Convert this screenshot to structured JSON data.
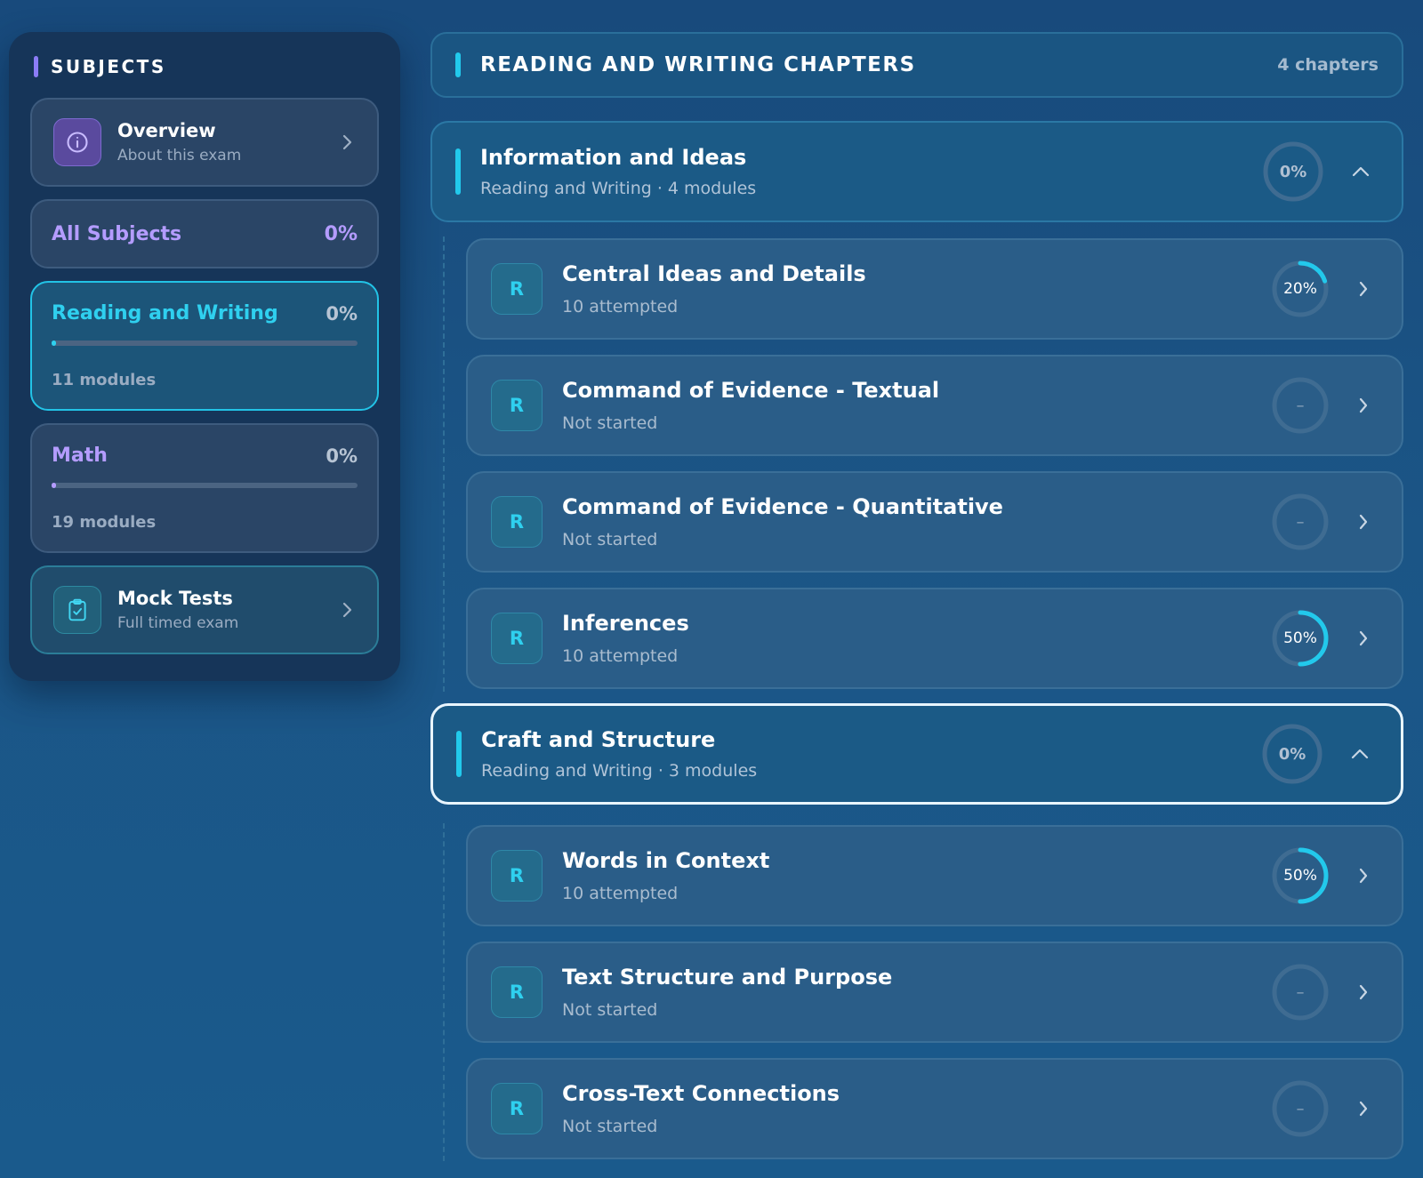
{
  "colors": {
    "accent_cyan": "#22c9ec",
    "accent_purple": "#8b7cf6",
    "reading_color": "#2fd0ef",
    "math_color": "#b49cff",
    "ring_track": "#3f6c92"
  },
  "sidebar": {
    "heading": "SUBJECTS",
    "overview": {
      "icon": "info-icon",
      "title": "Overview",
      "subtitle": "About this exam"
    },
    "all_subjects": {
      "label": "All Subjects",
      "percent": "0%"
    },
    "subjects": [
      {
        "name": "Reading and Writing",
        "percent": "0%",
        "progress": 0.01,
        "modules": "11 modules",
        "active": true
      },
      {
        "name": "Math",
        "percent": "0%",
        "progress": 0.01,
        "modules": "19 modules",
        "active": false
      }
    ],
    "mock_tests": {
      "icon": "clipboard-check-icon",
      "title": "Mock Tests",
      "subtitle": "Full timed exam"
    }
  },
  "main": {
    "header": {
      "title": "READING AND WRITING CHAPTERS",
      "count": "4 chapters"
    },
    "chapters": [
      {
        "title": "Information and Ideas",
        "subtitle": "Reading and Writing · 4 modules",
        "percent": "0%",
        "selected": false,
        "modules": [
          {
            "badge": "R",
            "title": "Central Ideas and Details",
            "status": "10 attempted",
            "ring": "20%",
            "progress": 0.2
          },
          {
            "badge": "R",
            "title": "Command of Evidence - Textual",
            "status": "Not started",
            "ring": "–",
            "progress": 0
          },
          {
            "badge": "R",
            "title": "Command of Evidence - Quantitative",
            "status": "Not started",
            "ring": "–",
            "progress": 0
          },
          {
            "badge": "R",
            "title": "Inferences",
            "status": "10 attempted",
            "ring": "50%",
            "progress": 0.5
          }
        ]
      },
      {
        "title": "Craft and Structure",
        "subtitle": "Reading and Writing · 3 modules",
        "percent": "0%",
        "selected": true,
        "modules": [
          {
            "badge": "R",
            "title": "Words in Context",
            "status": "10 attempted",
            "ring": "50%",
            "progress": 0.5
          },
          {
            "badge": "R",
            "title": "Text Structure and Purpose",
            "status": "Not started",
            "ring": "–",
            "progress": 0
          },
          {
            "badge": "R",
            "title": "Cross-Text Connections",
            "status": "Not started",
            "ring": "–",
            "progress": 0
          }
        ]
      }
    ]
  }
}
